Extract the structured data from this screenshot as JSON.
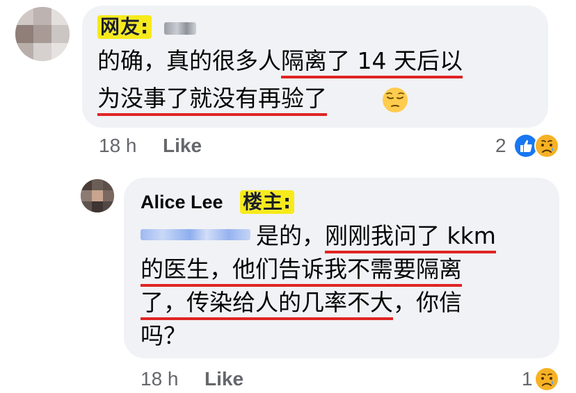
{
  "comment1": {
    "tag": "网友:",
    "line1_plain": "的确，真的很多人",
    "line1_hl": "隔离了 14 天后以",
    "line2_hl": "为没事了就没有再验了",
    "emoji_icon": "pensive-face-icon",
    "time": "18 h",
    "like": "Like",
    "reaction_count": "2",
    "reaction_icons": [
      "like-reaction-icon",
      "sad-reaction-icon"
    ]
  },
  "comment2": {
    "author": "Alice Lee",
    "tag": "楼主:",
    "line1_plain": "是的，",
    "line1_hl": "刚刚我问了 kkm",
    "line2_hl": "的医生，他们告诉我不需要隔离",
    "line3_hl": "了，传染给人的几率不大",
    "line3_plain": "，你信",
    "line4": "吗？",
    "time": "18 h",
    "like": "Like",
    "reaction_count": "1",
    "reaction_icons": [
      "sad-reaction-icon"
    ]
  },
  "colors": {
    "bubble": "#f0f2f5",
    "highlight_underline": "#e02424",
    "tag_bg": "#f7ea1a",
    "meta_text": "#65676b",
    "like_blue": "#1877f2",
    "sad_yellow": "#f7b125"
  }
}
